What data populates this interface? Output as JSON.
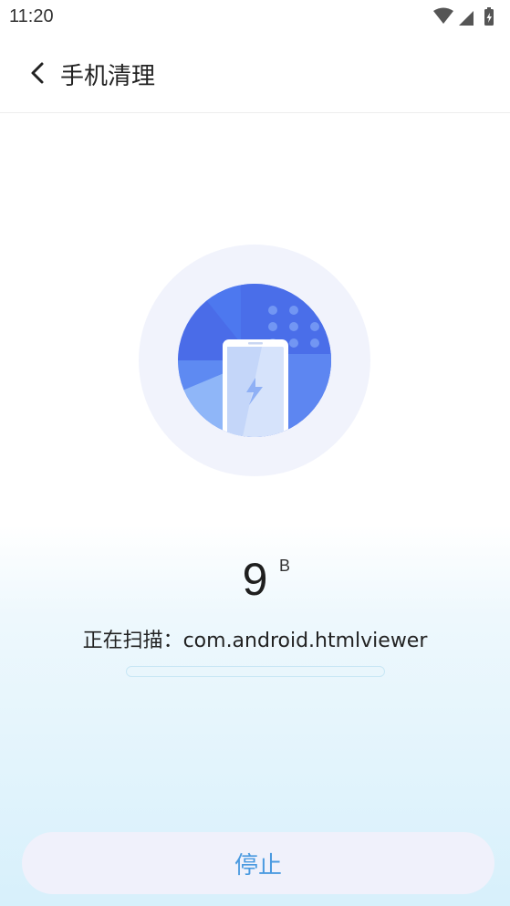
{
  "status_bar": {
    "time": "11:20"
  },
  "header": {
    "title": "手机清理"
  },
  "scan": {
    "size_value": "9",
    "size_unit": "B",
    "status_text": "正在扫描：com.android.htmlviewer",
    "progress": 0
  },
  "actions": {
    "stop_label": "停止"
  },
  "colors": {
    "accent": "#4a9ae0",
    "illustration_blue": "#4f74ee",
    "button_bg": "#f0f1fb"
  }
}
